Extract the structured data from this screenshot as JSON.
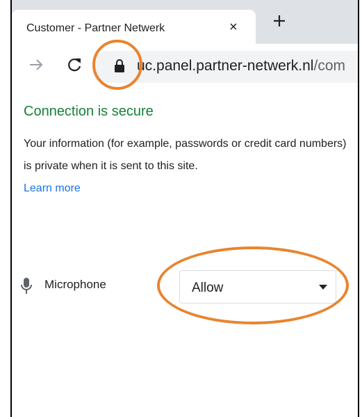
{
  "tab": {
    "title": "Customer - Partner Netwerk",
    "close_glyph": "×",
    "new_tab_icon": "plus-icon"
  },
  "toolbar": {
    "forward_icon": "arrow-right-icon",
    "reload_icon": "reload-icon",
    "lock_icon": "lock-icon",
    "url_host": "uc.panel.partner-netwerk.nl",
    "url_rest": "/com"
  },
  "popup": {
    "title": "Connection is secure",
    "description": "Your information (for example, passwords or credit card numbers) is private when it is sent to this site.",
    "learn_more": "Learn more",
    "permission": {
      "icon": "microphone-icon",
      "label": "Microphone",
      "value": "Allow"
    }
  },
  "colors": {
    "secure_green": "#188038",
    "link_blue": "#1a73e8",
    "annotation_orange": "#e9842f",
    "tabstrip": "#dee1e6"
  }
}
